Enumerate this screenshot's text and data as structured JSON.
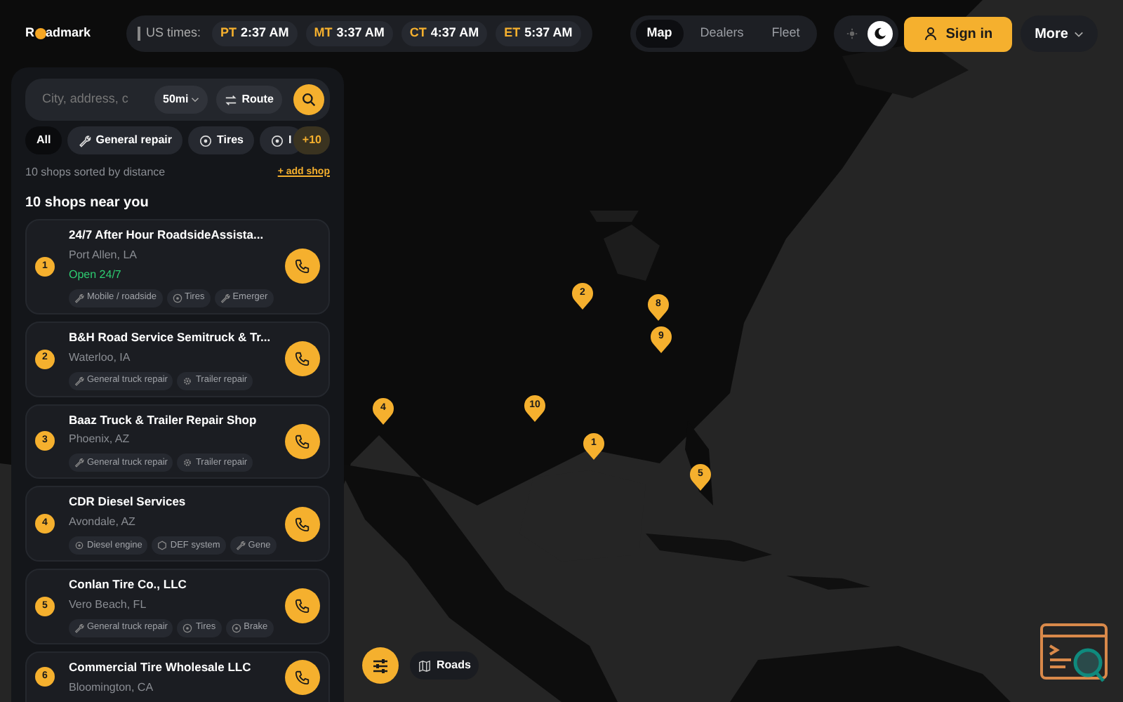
{
  "logo": {
    "before": "R",
    "after": "admark"
  },
  "us_times": {
    "label": "US times:",
    "zones": [
      {
        "zone": "PT",
        "time": "2:37 AM"
      },
      {
        "zone": "MT",
        "time": "3:37 AM"
      },
      {
        "zone": "CT",
        "time": "4:37 AM"
      },
      {
        "zone": "ET",
        "time": "5:37 AM"
      }
    ]
  },
  "nav_tabs": [
    {
      "label": "Map",
      "selected": true
    },
    {
      "label": "Dealers",
      "selected": false
    },
    {
      "label": "Fleet",
      "selected": false
    }
  ],
  "theme_toggle": [
    {
      "selected": false
    },
    {
      "selected": true
    }
  ],
  "sign_in": "Sign in",
  "more": "More",
  "search": {
    "placeholder": "City, address, c",
    "radius": "50mi",
    "route": "Route"
  },
  "filters": [
    {
      "label": "All",
      "kind": "all",
      "selected": true
    },
    {
      "label": "General repair",
      "kind": "repair",
      "selected": false
    },
    {
      "label": "Tires",
      "kind": "tires",
      "selected": false
    },
    {
      "label": "I",
      "kind": "tires",
      "selected": false
    }
  ],
  "more_filters": "+10",
  "summary": "10 shops sorted by distance",
  "add_shop": "+ add shop",
  "heading": "10 shops near you",
  "shops": [
    {
      "rank": "1",
      "name": "24/7 After Hour RoadsideAssista...",
      "location": "Port Allen, LA",
      "hours": "Open 24/7",
      "tags": [
        {
          "label": "Mobile / roadside",
          "kind": "repair"
        },
        {
          "label": "Tires",
          "kind": "tires"
        },
        {
          "label": "Emerger",
          "kind": "repair"
        }
      ]
    },
    {
      "rank": "2",
      "name": "B&H Road Service Semitruck & Tr...",
      "location": "Waterloo, IA",
      "tags": [
        {
          "label": "General truck repair",
          "kind": "repair"
        },
        {
          "label": "Trailer repair",
          "kind": "trailer"
        }
      ]
    },
    {
      "rank": "3",
      "name": "Baaz Truck & Trailer Repair Shop",
      "location": "Phoenix, AZ",
      "tags": [
        {
          "label": "General truck repair",
          "kind": "repair"
        },
        {
          "label": "Trailer repair",
          "kind": "trailer"
        }
      ]
    },
    {
      "rank": "4",
      "name": "CDR Diesel Services",
      "location": "Avondale, AZ",
      "tags": [
        {
          "label": "Diesel engine",
          "kind": "engine"
        },
        {
          "label": "DEF system",
          "kind": "def"
        },
        {
          "label": "Gene",
          "kind": "repair"
        }
      ]
    },
    {
      "rank": "5",
      "name": "Conlan Tire Co., LLC",
      "location": "Vero Beach, FL",
      "tags": [
        {
          "label": "General truck repair",
          "kind": "repair"
        },
        {
          "label": "Tires",
          "kind": "tires"
        },
        {
          "label": "Brake",
          "kind": "tires"
        }
      ]
    },
    {
      "rank": "6",
      "name": "Commercial Tire Wholesale LLC",
      "location": "Bloomington, CA"
    }
  ],
  "map": {
    "kind": "picture",
    "pins": [
      "1",
      "2",
      "4",
      "5",
      "8",
      "9",
      "10"
    ],
    "layers_button": "Roads"
  }
}
